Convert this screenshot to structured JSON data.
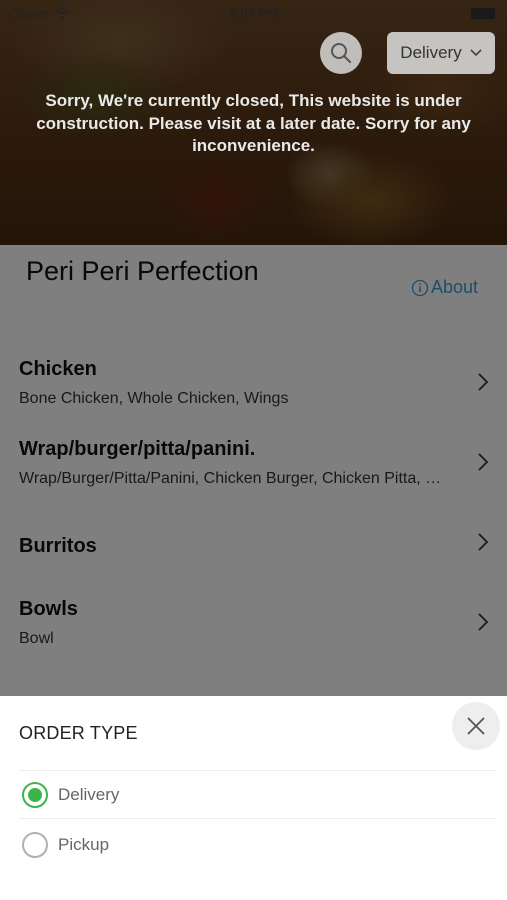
{
  "status_bar": {
    "carrier": "Carrier",
    "time": "6:07 PM"
  },
  "header": {
    "order_type_selected": "Delivery",
    "closed_message": "Sorry, We're currently closed, This website is under construction. Please visit at a later date. Sorry for any inconvenience."
  },
  "store": {
    "name": "Peri Peri Perfection",
    "about_label": "About"
  },
  "categories": [
    {
      "title": "Chicken",
      "subtitle": "Bone Chicken, Whole Chicken, Wings"
    },
    {
      "title": "Wrap/burger/pitta/panini.",
      "subtitle": "Wrap/Burger/Pitta/Panini, Chicken Burger, Chicken Pitta, Chicken Panini"
    },
    {
      "title": "Burritos",
      "subtitle": ""
    },
    {
      "title": "Bowls",
      "subtitle": "Bowl"
    }
  ],
  "order_sheet": {
    "title": "ORDER TYPE",
    "options": [
      {
        "label": "Delivery",
        "selected": true
      },
      {
        "label": "Pickup",
        "selected": false
      }
    ]
  },
  "colors": {
    "accent_link": "#3a9bd6",
    "radio_selected": "#3bb54a"
  }
}
